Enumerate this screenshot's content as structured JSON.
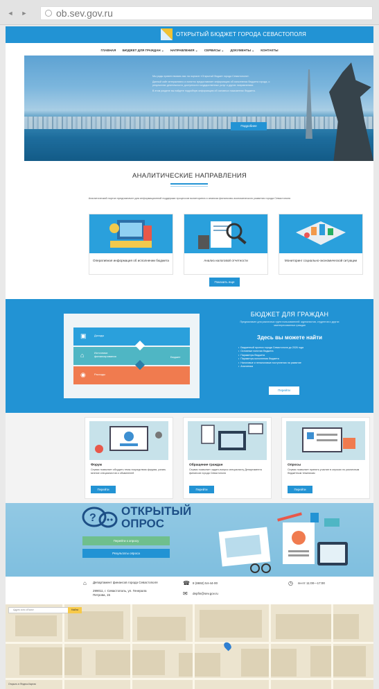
{
  "browser": {
    "back": "◄",
    "forward": "►",
    "url": "ob.sev.gov.ru"
  },
  "header": {
    "site_title": "ОТКРЫТЫЙ БЮДЖЕТ ГОРОДА СЕВАСТОПОЛЯ",
    "menu": [
      "ГЛАВНАЯ",
      "БЮДЖЕТ ДЛЯ ГРАЖДАН ⌄",
      "НАПРАВЛЕНИЯ ⌄",
      "СЕРВИСЫ ⌄",
      "ДОКУМЕНТЫ ⌄",
      "КОНТАКТЫ"
    ]
  },
  "hero": {
    "paragraphs": [
      "Мы рады приветствовать вас на портале «Открытый бюджет города Севастополя».",
      "Данный сайт интерактивно и понятно предоставляет информацию об исполнении бюджета города, о результатах деятельности, доступности государственных услуг и других направлениях.",
      "В этом разделе вы найдете подробную информацию об основных показателях бюджета."
    ],
    "button": "Подробнее"
  },
  "analytics": {
    "title": "АНАЛИТИЧЕСКИЕ НАПРАВЛЕНИЯ",
    "subtitle": "Аналитический портал предназначен для информационной поддержки процессов мониторинга и анализа финансово-экономического развития города Севастополя",
    "cards": [
      "Оперативная информация об исполнении бюджета",
      "Анализ налоговой отчетности",
      "Мониторинг социально-экономической ситуации"
    ],
    "more_button": "Показать еще"
  },
  "budget": {
    "heading": "БЮДЖЕТ ДЛЯ ГРАЖДАН",
    "subtitle": "Предназначен для различных групп пользователей: журналистов, студентов и других заинтересованных граждан",
    "find_heading": "Здесь вы можете найти",
    "items": [
      "Бюджетный прогноз города Севастополя до 2026 года",
      "Основные понятия бюджета",
      "Параметры бюджета",
      "Параметры исполнения бюджета",
      "Налоговые и неналоговые поступления на развитие",
      "Аналитика"
    ],
    "illus_labels": [
      "Доходы",
      "Источники финансирования",
      "Расходы",
      "Бюджет"
    ],
    "button": "Перейти"
  },
  "services": [
    {
      "title": "Форум",
      "text": "Сервис позволяет обсудить темы посредством форума, узнать мнение специалистов и обывателей",
      "button": "Перейти"
    },
    {
      "title": "Обращение граждан",
      "text": "Сервис позволяет задать вопрос специалисту Департамента финансов города Севастополя",
      "button": "Перейти"
    },
    {
      "title": "Опросы",
      "text": "Сервис позволяет принять участие в опросах по различным бюджетным тематикам",
      "button": "Перейти"
    }
  ],
  "poll": {
    "heading_line1": "ОТКРЫТЫЙ",
    "heading_line2": "ОПРОС",
    "button_primary": "Перейти к опросу",
    "button_secondary": "Результаты опроса"
  },
  "contacts": {
    "org": "Департамент финансов города Севастополя",
    "address": "299011, г. Севастополь, ул. Генерала Петрова, 15",
    "phone": "8 (8692) 54-44-00",
    "email": "depfin@sev.gov.ru",
    "hours": "пн-пт 11:00—17:00"
  },
  "map": {
    "search_placeholder": "Адрес или объект",
    "search_button": "Найти",
    "credit": "Открыть в Яндекс.Картах"
  },
  "colors": {
    "brand_blue": "#2293d4",
    "orange": "#f07b4f",
    "teal": "#4fb6c4",
    "poll_bg": "#7fbfdf"
  }
}
